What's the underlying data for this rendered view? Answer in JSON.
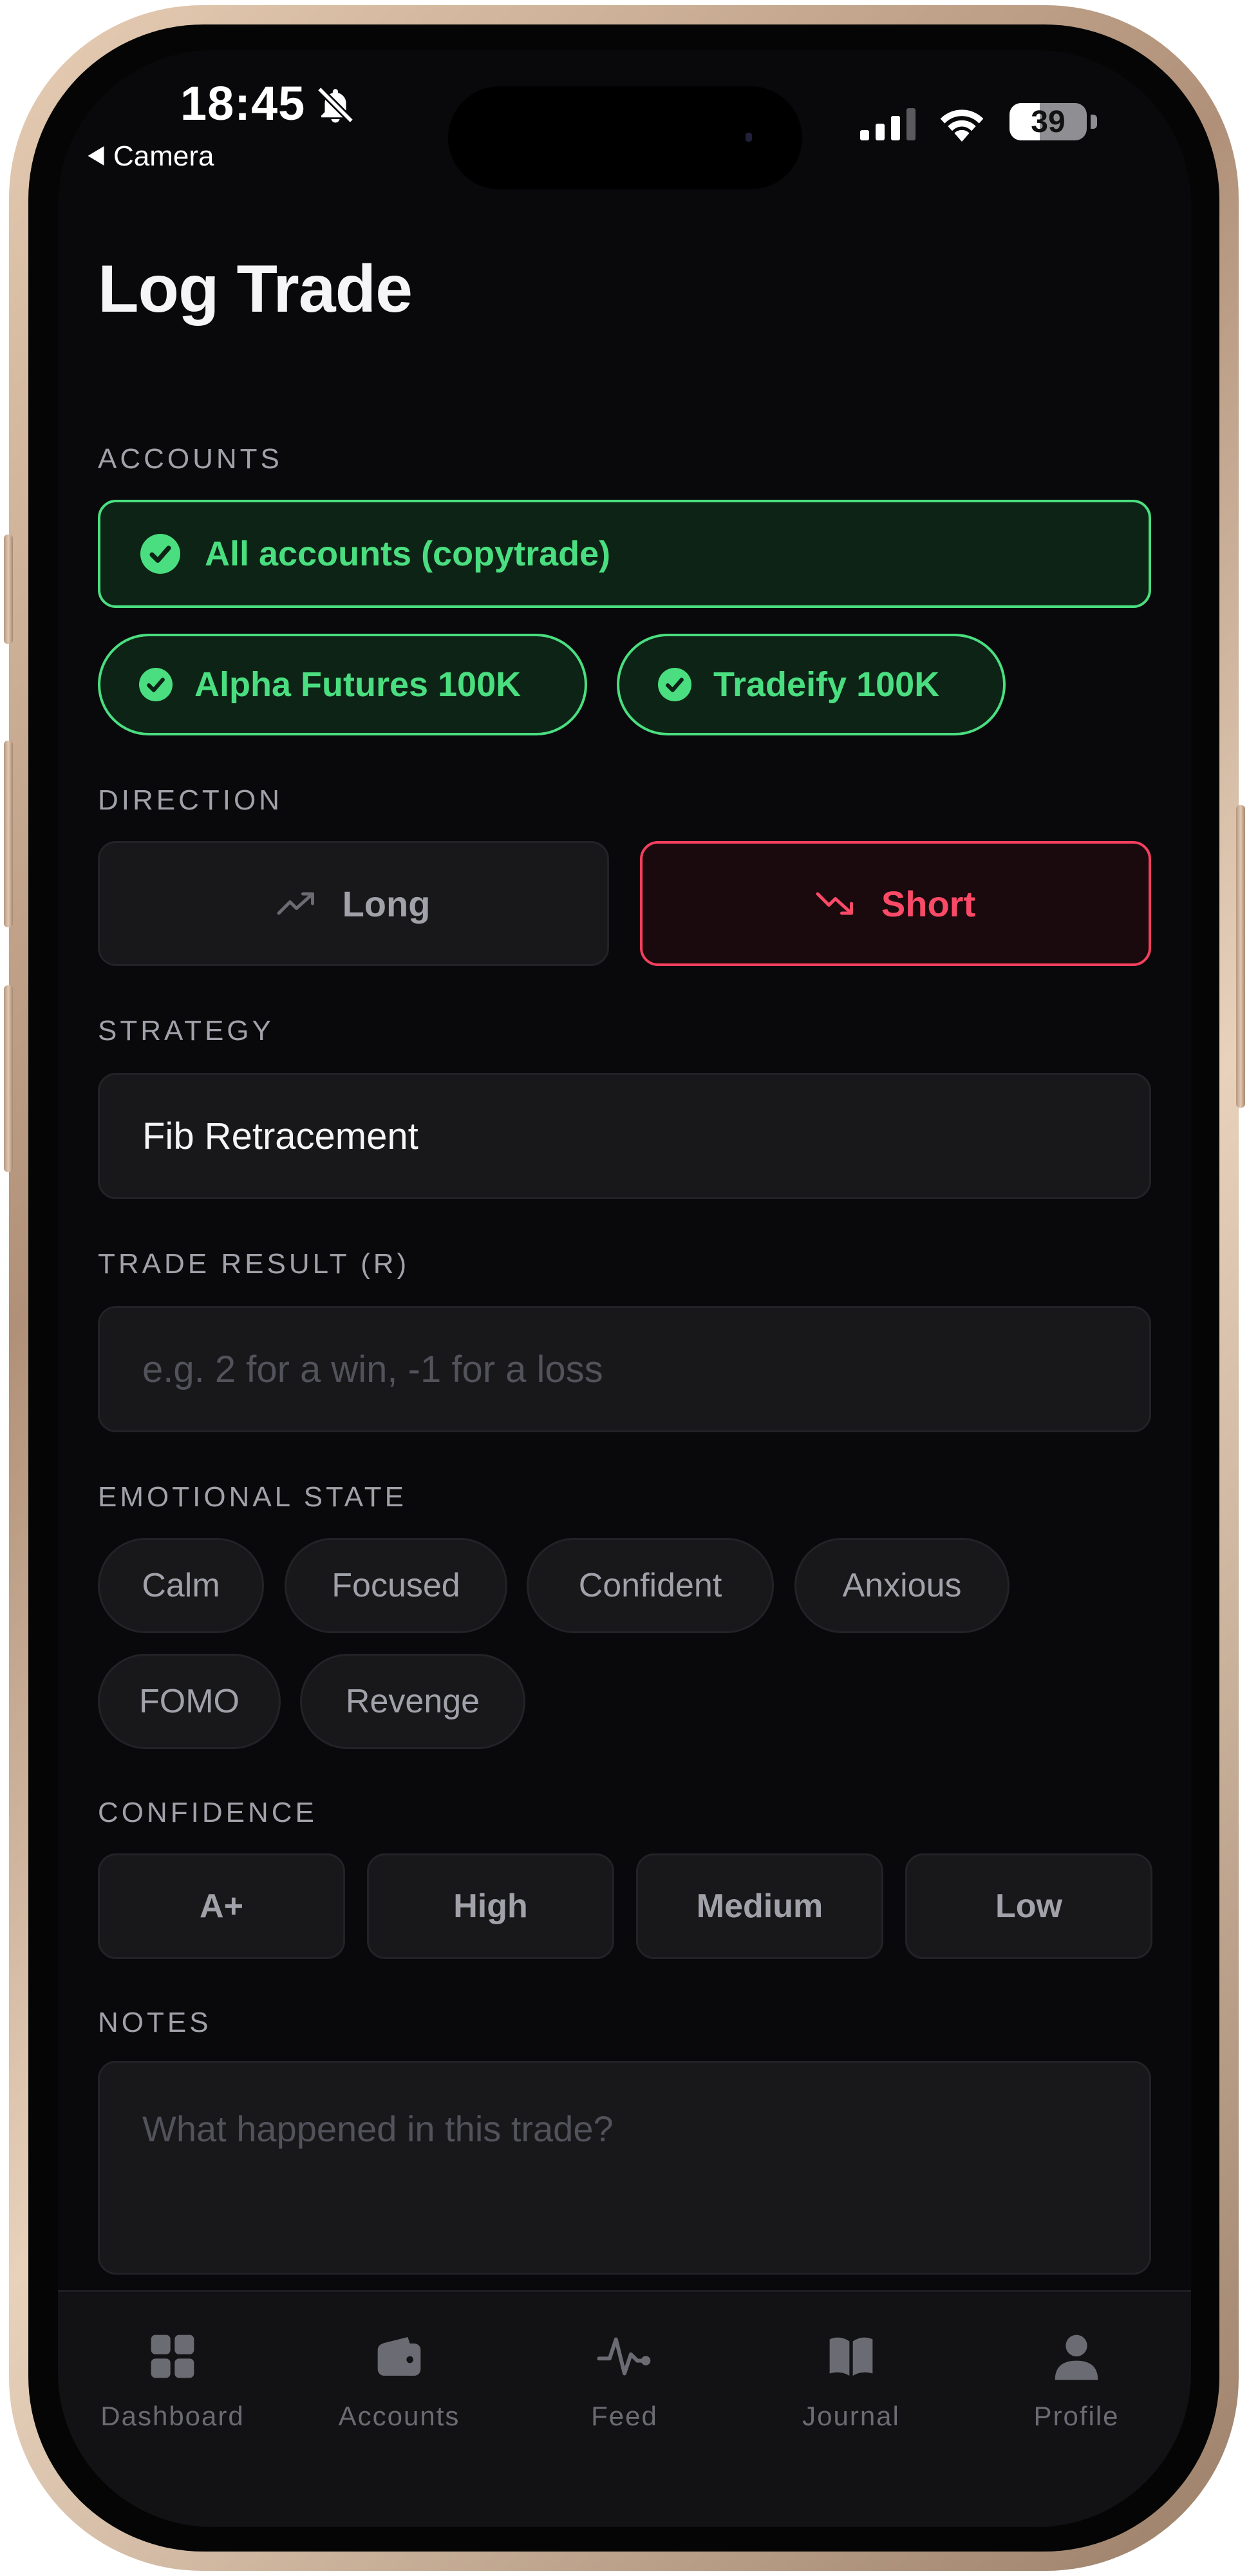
{
  "status_bar": {
    "time": "18:45",
    "back_app": "Camera",
    "battery_percent": "39",
    "battery_level": 0.39
  },
  "page": {
    "title": "Log Trade"
  },
  "accounts": {
    "label": "ACCOUNTS",
    "all_label": "All accounts (copytrade)",
    "items": [
      "Alpha Futures 100K",
      "Tradeify 100K"
    ]
  },
  "direction": {
    "label": "DIRECTION",
    "long": "Long",
    "short": "Short",
    "selected": "Short"
  },
  "strategy": {
    "label": "STRATEGY",
    "value": "Fib Retracement"
  },
  "trade_result": {
    "label": "TRADE RESULT (R)",
    "placeholder": "e.g. 2 for a win, -1 for a loss"
  },
  "emotional_state": {
    "label": "EMOTIONAL STATE",
    "options": [
      "Calm",
      "Focused",
      "Confident",
      "Anxious",
      "FOMO",
      "Revenge"
    ]
  },
  "confidence": {
    "label": "CONFIDENCE",
    "options": [
      "A+",
      "High",
      "Medium",
      "Low"
    ]
  },
  "notes": {
    "label": "NOTES",
    "placeholder": "What happened in this trade?"
  },
  "tabbar": {
    "items": [
      {
        "label": "Dashboard",
        "icon": "grid-icon"
      },
      {
        "label": "Accounts",
        "icon": "wallet-icon"
      },
      {
        "label": "Feed",
        "icon": "pulse-icon"
      },
      {
        "label": "Journal",
        "icon": "book-icon"
      },
      {
        "label": "Profile",
        "icon": "user-icon"
      }
    ]
  },
  "colors": {
    "accent_green": "#4ade80",
    "accent_red": "#f43f5e",
    "background": "#09090b",
    "surface": "#18181b"
  }
}
